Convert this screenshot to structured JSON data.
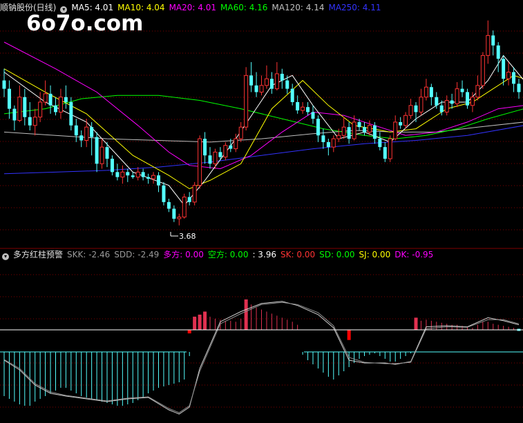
{
  "watermark": "6o7o.com",
  "main_panel": {
    "stock_label": "顺钠股份(日线)",
    "icon": "chevron-down-icon",
    "indicators": [
      {
        "label": "MA5: 4.01",
        "color": "#ffffff"
      },
      {
        "label": "MA10: 4.04",
        "color": "#ffff00"
      },
      {
        "label": "MA20: 4.01",
        "color": "#ff00ff"
      },
      {
        "label": "MA60: 4.16",
        "color": "#00ff00"
      },
      {
        "label": "MA120: 4.14",
        "color": "#c0c0c0"
      },
      {
        "label": "MA250: 4.11",
        "color": "#3333ff"
      }
    ],
    "low_label": "3.68"
  },
  "sub_panel": {
    "title": "多方红柱预警",
    "icon": "chevron-down-icon",
    "indicators": [
      {
        "label": "SKK: -2.46",
        "color": "#9a9a9a"
      },
      {
        "label": "SDD: -2.49",
        "color": "#9a9a9a"
      },
      {
        "label": "多方: 0.00",
        "color": "#ff00ff"
      },
      {
        "label": "空方: 0.00",
        "color": "#00ff00"
      },
      {
        "label": ": 3.96",
        "color": "#ffffff"
      },
      {
        "label": "SK: 0.00",
        "color": "#ff3333"
      },
      {
        "label": "SD: 0.00",
        "color": "#00ff00"
      },
      {
        "label": "SJ: 0.00",
        "color": "#ffff00"
      },
      {
        "label": "DK: -0.95",
        "color": "#ff00ff"
      }
    ]
  },
  "colors": {
    "up": "#ff3333",
    "down": "#54ffff",
    "grid": "#800000",
    "red_bar": "#e03050",
    "cyan_bar": "#54ffff"
  },
  "chart_data": {
    "type": "candlestick",
    "ylim": [
      3.55,
      4.95
    ],
    "candles": [
      [
        4.55,
        4.5,
        4.62,
        4.45
      ],
      [
        4.5,
        4.38,
        4.55,
        4.32
      ],
      [
        4.38,
        4.31,
        4.4,
        4.25
      ],
      [
        4.31,
        4.45,
        4.52,
        4.3
      ],
      [
        4.45,
        4.33,
        4.5,
        4.28
      ],
      [
        4.33,
        4.28,
        4.42,
        4.25
      ],
      [
        4.28,
        4.33,
        4.38,
        4.22
      ],
      [
        4.33,
        4.42,
        4.48,
        4.3
      ],
      [
        4.42,
        4.47,
        4.55,
        4.4
      ],
      [
        4.47,
        4.4,
        4.52,
        4.35
      ],
      [
        4.4,
        4.36,
        4.45,
        4.34
      ],
      [
        4.36,
        4.45,
        4.5,
        4.32
      ],
      [
        4.45,
        4.42,
        4.52,
        4.38
      ],
      [
        4.42,
        4.28,
        4.45,
        4.25
      ],
      [
        4.28,
        4.22,
        4.32,
        4.18
      ],
      [
        4.22,
        4.19,
        4.25,
        4.15
      ],
      [
        4.19,
        4.27,
        4.32,
        4.15
      ],
      [
        4.27,
        4.21,
        4.3,
        4.1
      ],
      [
        4.21,
        4.05,
        4.24,
        4.0
      ],
      [
        4.05,
        4.15,
        4.2,
        4.02
      ],
      [
        4.15,
        4.08,
        4.18,
        4.03
      ],
      [
        4.08,
        4.0,
        4.1,
        3.98
      ],
      [
        4.0,
        3.97,
        4.05,
        3.95
      ],
      [
        3.97,
        4.0,
        4.04,
        3.93
      ],
      [
        4.0,
        3.98,
        4.02,
        3.94
      ],
      [
        3.98,
        3.97,
        4.0,
        3.96
      ],
      [
        3.97,
        4.0,
        4.03,
        3.95
      ],
      [
        4.0,
        3.97,
        4.02,
        3.95
      ],
      [
        3.97,
        3.96,
        3.99,
        3.93
      ],
      [
        3.96,
        3.98,
        4.0,
        3.93
      ],
      [
        3.98,
        3.92,
        4.0,
        3.88
      ],
      [
        3.92,
        3.82,
        3.94,
        3.8
      ],
      [
        3.82,
        3.78,
        3.84,
        3.76
      ],
      [
        3.78,
        3.72,
        3.8,
        3.7
      ],
      [
        3.72,
        3.73,
        3.75,
        3.68
      ],
      [
        3.73,
        3.85,
        3.87,
        3.72
      ],
      [
        3.85,
        3.82,
        3.88,
        3.8
      ],
      [
        3.82,
        3.92,
        3.94,
        3.8
      ],
      [
        3.92,
        4.2,
        4.22,
        3.9
      ],
      [
        4.2,
        4.1,
        4.24,
        4.05
      ],
      [
        4.1,
        4.05,
        4.15,
        4.02
      ],
      [
        4.05,
        4.12,
        4.14,
        4.02
      ],
      [
        4.12,
        4.09,
        4.15,
        4.07
      ],
      [
        4.09,
        4.16,
        4.18,
        4.07
      ],
      [
        4.16,
        4.14,
        4.2,
        4.12
      ],
      [
        4.14,
        4.2,
        4.23,
        4.12
      ],
      [
        4.2,
        4.27,
        4.3,
        4.18
      ],
      [
        4.27,
        4.58,
        4.63,
        4.25
      ],
      [
        4.58,
        4.52,
        4.66,
        4.48
      ],
      [
        4.52,
        4.48,
        4.6,
        4.45
      ],
      [
        4.48,
        4.52,
        4.58,
        4.46
      ],
      [
        4.52,
        4.56,
        4.64,
        4.5
      ],
      [
        4.56,
        4.5,
        4.6,
        4.47
      ],
      [
        4.5,
        4.59,
        4.66,
        4.49
      ],
      [
        4.59,
        4.55,
        4.62,
        4.5
      ],
      [
        4.55,
        4.5,
        4.58,
        4.47
      ],
      [
        4.5,
        4.42,
        4.53,
        4.4
      ],
      [
        4.42,
        4.37,
        4.46,
        4.35
      ],
      [
        4.37,
        4.39,
        4.42,
        4.35
      ],
      [
        4.39,
        4.36,
        4.42,
        4.34
      ],
      [
        4.36,
        4.32,
        4.4,
        4.29
      ],
      [
        4.32,
        4.22,
        4.34,
        4.18
      ],
      [
        4.22,
        4.18,
        4.26,
        4.14
      ],
      [
        4.18,
        4.15,
        4.2,
        4.1
      ],
      [
        4.15,
        4.2,
        4.22,
        4.12
      ],
      [
        4.2,
        4.22,
        4.26,
        4.18
      ],
      [
        4.22,
        4.27,
        4.33,
        4.2
      ],
      [
        4.27,
        4.2,
        4.3,
        4.17
      ],
      [
        4.2,
        4.3,
        4.34,
        4.19
      ],
      [
        4.3,
        4.27,
        4.32,
        4.25
      ],
      [
        4.27,
        4.24,
        4.3,
        4.22
      ],
      [
        4.24,
        4.28,
        4.31,
        4.22
      ],
      [
        4.28,
        4.2,
        4.3,
        4.17
      ],
      [
        4.2,
        4.15,
        4.24,
        4.13
      ],
      [
        4.15,
        4.08,
        4.18,
        4.06
      ],
      [
        4.08,
        4.2,
        4.22,
        4.06
      ],
      [
        4.2,
        4.3,
        4.34,
        4.19
      ],
      [
        4.3,
        4.28,
        4.33,
        4.26
      ],
      [
        4.28,
        4.34,
        4.36,
        4.26
      ],
      [
        4.34,
        4.4,
        4.44,
        4.32
      ],
      [
        4.4,
        4.36,
        4.42,
        4.3
      ],
      [
        4.36,
        4.45,
        4.5,
        4.34
      ],
      [
        4.45,
        4.51,
        4.56,
        4.43
      ],
      [
        4.51,
        4.45,
        4.53,
        4.4
      ],
      [
        4.45,
        4.4,
        4.48,
        4.38
      ],
      [
        4.4,
        4.36,
        4.43,
        4.34
      ],
      [
        4.36,
        4.43,
        4.46,
        4.34
      ],
      [
        4.43,
        4.41,
        4.47,
        4.38
      ],
      [
        4.41,
        4.5,
        4.54,
        4.39
      ],
      [
        4.5,
        4.48,
        4.55,
        4.45
      ],
      [
        4.48,
        4.4,
        4.5,
        4.38
      ],
      [
        4.4,
        4.45,
        4.48,
        4.36
      ],
      [
        4.45,
        4.52,
        4.58,
        4.43
      ],
      [
        4.52,
        4.7,
        4.72,
        4.5
      ],
      [
        4.7,
        4.82,
        4.91,
        4.65
      ],
      [
        4.82,
        4.76,
        4.85,
        4.7
      ],
      [
        4.76,
        4.68,
        4.78,
        4.6
      ],
      [
        4.68,
        4.56,
        4.7,
        4.52
      ],
      [
        4.56,
        4.6,
        4.66,
        4.52
      ],
      [
        4.6,
        4.53,
        4.63,
        4.48
      ],
      [
        4.53,
        4.48,
        4.56,
        4.44
      ]
    ],
    "ma": {
      "MA5": [
        [
          0,
          4.6
        ],
        [
          8,
          4.42
        ],
        [
          16,
          4.3
        ],
        [
          25,
          4.0
        ],
        [
          32,
          3.92
        ],
        [
          35,
          3.8
        ],
        [
          39,
          3.95
        ],
        [
          45,
          4.2
        ],
        [
          52,
          4.52
        ],
        [
          56,
          4.58
        ],
        [
          60,
          4.4
        ],
        [
          65,
          4.2
        ],
        [
          70,
          4.24
        ],
        [
          75,
          4.18
        ],
        [
          80,
          4.32
        ],
        [
          85,
          4.42
        ],
        [
          90,
          4.42
        ],
        [
          94,
          4.55
        ],
        [
          97,
          4.7
        ],
        [
          101,
          4.55
        ]
      ],
      "MA10": [
        [
          0,
          4.62
        ],
        [
          8,
          4.48
        ],
        [
          16,
          4.35
        ],
        [
          25,
          4.1
        ],
        [
          32,
          3.98
        ],
        [
          36,
          3.9
        ],
        [
          40,
          3.95
        ],
        [
          46,
          4.05
        ],
        [
          52,
          4.38
        ],
        [
          58,
          4.55
        ],
        [
          63,
          4.4
        ],
        [
          68,
          4.28
        ],
        [
          75,
          4.24
        ],
        [
          80,
          4.26
        ],
        [
          86,
          4.38
        ],
        [
          91,
          4.42
        ],
        [
          95,
          4.5
        ],
        [
          99,
          4.58
        ],
        [
          101,
          4.56
        ]
      ],
      "MA20": [
        [
          0,
          4.78
        ],
        [
          10,
          4.62
        ],
        [
          18,
          4.48
        ],
        [
          26,
          4.28
        ],
        [
          32,
          4.12
        ],
        [
          36,
          4.04
        ],
        [
          42,
          4.02
        ],
        [
          48,
          4.1
        ],
        [
          54,
          4.24
        ],
        [
          60,
          4.36
        ],
        [
          66,
          4.34
        ],
        [
          72,
          4.28
        ],
        [
          78,
          4.22
        ],
        [
          84,
          4.24
        ],
        [
          90,
          4.3
        ],
        [
          96,
          4.38
        ],
        [
          101,
          4.4
        ]
      ],
      "MA60": [
        [
          0,
          4.35
        ],
        [
          8,
          4.38
        ],
        [
          15,
          4.44
        ],
        [
          22,
          4.46
        ],
        [
          30,
          4.46
        ],
        [
          38,
          4.43
        ],
        [
          46,
          4.38
        ],
        [
          54,
          4.32
        ],
        [
          62,
          4.26
        ],
        [
          70,
          4.22
        ],
        [
          76,
          4.2
        ],
        [
          82,
          4.22
        ],
        [
          88,
          4.26
        ],
        [
          94,
          4.32
        ],
        [
          101,
          4.38
        ]
      ],
      "MA120": [
        [
          0,
          4.24
        ],
        [
          10,
          4.22
        ],
        [
          20,
          4.2
        ],
        [
          30,
          4.19
        ],
        [
          40,
          4.18
        ],
        [
          50,
          4.2
        ],
        [
          60,
          4.23
        ],
        [
          68,
          4.25
        ],
        [
          76,
          4.24
        ],
        [
          84,
          4.24
        ],
        [
          92,
          4.27
        ],
        [
          101,
          4.3
        ]
      ],
      "MA250": [
        [
          0,
          3.99
        ],
        [
          10,
          4.0
        ],
        [
          20,
          4.01
        ],
        [
          30,
          4.03
        ],
        [
          40,
          4.06
        ],
        [
          50,
          4.1
        ],
        [
          60,
          4.14
        ],
        [
          70,
          4.17
        ],
        [
          80,
          4.19
        ],
        [
          90,
          4.22
        ],
        [
          101,
          4.28
        ]
      ]
    },
    "sub_ylim": [
      -5,
      6
    ],
    "bars": [
      -3.2,
      -3.4,
      -3.6,
      -3.8,
      -3.9,
      -3.9,
      -3.6,
      -3.4,
      -3.2,
      -3.0,
      -2.8,
      -2.6,
      -2.6,
      -2.8,
      -3.0,
      -3.2,
      -3.3,
      -3.4,
      -3.5,
      -3.6,
      -3.7,
      -3.8,
      -3.9,
      -3.9,
      -3.8,
      -3.7,
      -3.5,
      -3.3,
      -3.0,
      -2.8,
      -2.6,
      -2.5,
      -2.4,
      -2.3,
      -2.2,
      -2.0,
      -0.3,
      0.9,
      1.4,
      1.7,
      1.3,
      1.1,
      1.0,
      0.9,
      0.9,
      0.8,
      1.1,
      1.5,
      2.5,
      2.2,
      2.0,
      1.8,
      1.6,
      1.4,
      1.2,
      1.0,
      0.8,
      0.5,
      -0.2,
      -0.6,
      -0.9,
      -1.2,
      -1.5,
      -1.8,
      -2.0,
      -1.7,
      -1.4,
      -1.1,
      -0.8,
      -0.5,
      -0.3,
      -0.2,
      -0.1,
      -0.3,
      -0.5,
      -0.7,
      -0.7,
      -0.5,
      -0.3,
      -0.1,
      0.7,
      0.9,
      1.0,
      0.9,
      0.8,
      0.7,
      0.6,
      0.5,
      0.5,
      0.4,
      0.3,
      0.2,
      0.5,
      0.8,
      0.8,
      0.6,
      0.5,
      0.4,
      0.3,
      0.2,
      0.1,
      0.05,
      0.05
    ],
    "solid_bars": [
      [
        36,
        -0.35,
        "red"
      ],
      [
        37,
        1.3,
        "pink"
      ],
      [
        38,
        1.5,
        "pink"
      ],
      [
        39,
        1.8,
        "pink"
      ],
      [
        47,
        3.0,
        "pink"
      ],
      [
        67,
        -1.0,
        "red"
      ],
      [
        80,
        1.2,
        "pink"
      ],
      [
        100,
        0.1,
        "cyan"
      ]
    ],
    "skk": [
      [
        0,
        -0.6
      ],
      [
        3,
        -1.3
      ],
      [
        6,
        -2.4
      ],
      [
        9,
        -3.0
      ],
      [
        12,
        -3.2
      ],
      [
        16,
        -3.4
      ],
      [
        20,
        -3.6
      ],
      [
        24,
        -3.4
      ],
      [
        28,
        -3.3
      ],
      [
        32,
        -4.2
      ],
      [
        34,
        -4.5
      ],
      [
        36,
        -4.0
      ],
      [
        38,
        -1.2
      ],
      [
        42,
        0.8
      ],
      [
        46,
        1.8
      ],
      [
        50,
        2.6
      ],
      [
        54,
        2.8
      ],
      [
        57,
        2.4
      ],
      [
        61,
        1.5
      ],
      [
        64,
        0.2
      ],
      [
        67,
        -0.6
      ],
      [
        70,
        -0.8
      ],
      [
        74,
        -0.8
      ],
      [
        76,
        -0.9
      ],
      [
        79,
        -0.7
      ],
      [
        82,
        0.3
      ],
      [
        86,
        0.4
      ],
      [
        90,
        0.3
      ],
      [
        94,
        1.2
      ],
      [
        97,
        0.9
      ],
      [
        100,
        0.5
      ]
    ],
    "sdd": [
      [
        0,
        -0.55
      ],
      [
        3,
        -1.2
      ],
      [
        6,
        -2.3
      ],
      [
        9,
        -2.9
      ],
      [
        12,
        -3.15
      ],
      [
        16,
        -3.35
      ],
      [
        20,
        -3.55
      ],
      [
        24,
        -3.35
      ],
      [
        28,
        -3.25
      ],
      [
        32,
        -4.1
      ],
      [
        34,
        -4.4
      ],
      [
        36,
        -3.9
      ],
      [
        38,
        -1.4
      ],
      [
        42,
        0.6
      ],
      [
        46,
        1.6
      ],
      [
        50,
        2.5
      ],
      [
        54,
        2.7
      ],
      [
        57,
        2.5
      ],
      [
        61,
        1.7
      ],
      [
        64,
        0.4
      ],
      [
        67,
        -0.4
      ],
      [
        70,
        -0.75
      ],
      [
        74,
        -0.85
      ],
      [
        76,
        -0.85
      ],
      [
        79,
        -0.75
      ],
      [
        82,
        0.1
      ],
      [
        86,
        0.3
      ],
      [
        90,
        0.25
      ],
      [
        94,
        1.0
      ],
      [
        97,
        1.0
      ],
      [
        100,
        0.6
      ]
    ]
  }
}
